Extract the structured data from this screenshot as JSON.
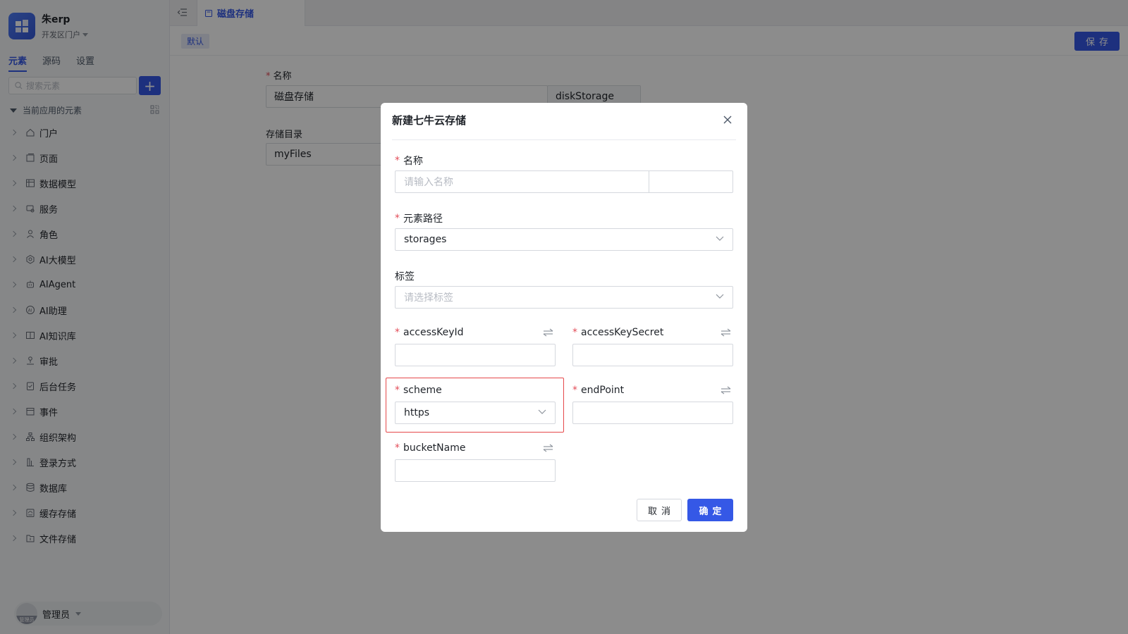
{
  "app": {
    "name": "朱erp",
    "portal": "开发区门户"
  },
  "sidebar": {
    "tabs": [
      "元素",
      "源码",
      "设置"
    ],
    "search_placeholder": "搜索元素",
    "add_label": "+",
    "root_label": "当前应用的元素",
    "items": [
      {
        "label": "门户",
        "icon": "home-icon"
      },
      {
        "label": "页面",
        "icon": "page-icon"
      },
      {
        "label": "数据模型",
        "icon": "table-icon"
      },
      {
        "label": "服务",
        "icon": "service-icon"
      },
      {
        "label": "角色",
        "icon": "role-icon"
      },
      {
        "label": "AI大模型",
        "icon": "ai-model-icon"
      },
      {
        "label": "AIAgent",
        "icon": "robot-icon"
      },
      {
        "label": "AI助理",
        "icon": "ai-assistant-icon"
      },
      {
        "label": "AI知识库",
        "icon": "knowledge-icon"
      },
      {
        "label": "审批",
        "icon": "approval-icon"
      },
      {
        "label": "后台任务",
        "icon": "task-icon"
      },
      {
        "label": "事件",
        "icon": "event-icon"
      },
      {
        "label": "组织架构",
        "icon": "org-icon"
      },
      {
        "label": "登录方式",
        "icon": "login-icon"
      },
      {
        "label": "数据库",
        "icon": "database-icon"
      },
      {
        "label": "缓存存储",
        "icon": "cache-icon"
      },
      {
        "label": "文件存储",
        "icon": "file-storage-icon"
      }
    ],
    "user": {
      "name": "管理员",
      "avatar_text": "管理员"
    }
  },
  "topbar": {
    "tab_label": "磁盘存储"
  },
  "subbar": {
    "tag": "默认",
    "save_label": "保存"
  },
  "background_form": {
    "name_label": "名称",
    "name_value": "磁盘存储",
    "name_code": "diskStorage",
    "dir_label": "存储目录",
    "dir_value": "myFiles"
  },
  "modal": {
    "title": "新建七牛云存储",
    "name_label": "名称",
    "name_placeholder": "请输入名称",
    "path_label": "元素路径",
    "path_value": "storages",
    "tags_label": "标签",
    "tags_placeholder": "请选择标签",
    "access_key_id_label": "accessKeyId",
    "access_key_secret_label": "accessKeySecret",
    "scheme_label": "scheme",
    "scheme_value": "https",
    "endpoint_label": "endPoint",
    "bucket_label": "bucketName",
    "cancel_label": "取消",
    "ok_label": "确定"
  },
  "colors": {
    "primary": "#3558e6",
    "required": "#e34d59",
    "highlight": "#e6484a"
  }
}
